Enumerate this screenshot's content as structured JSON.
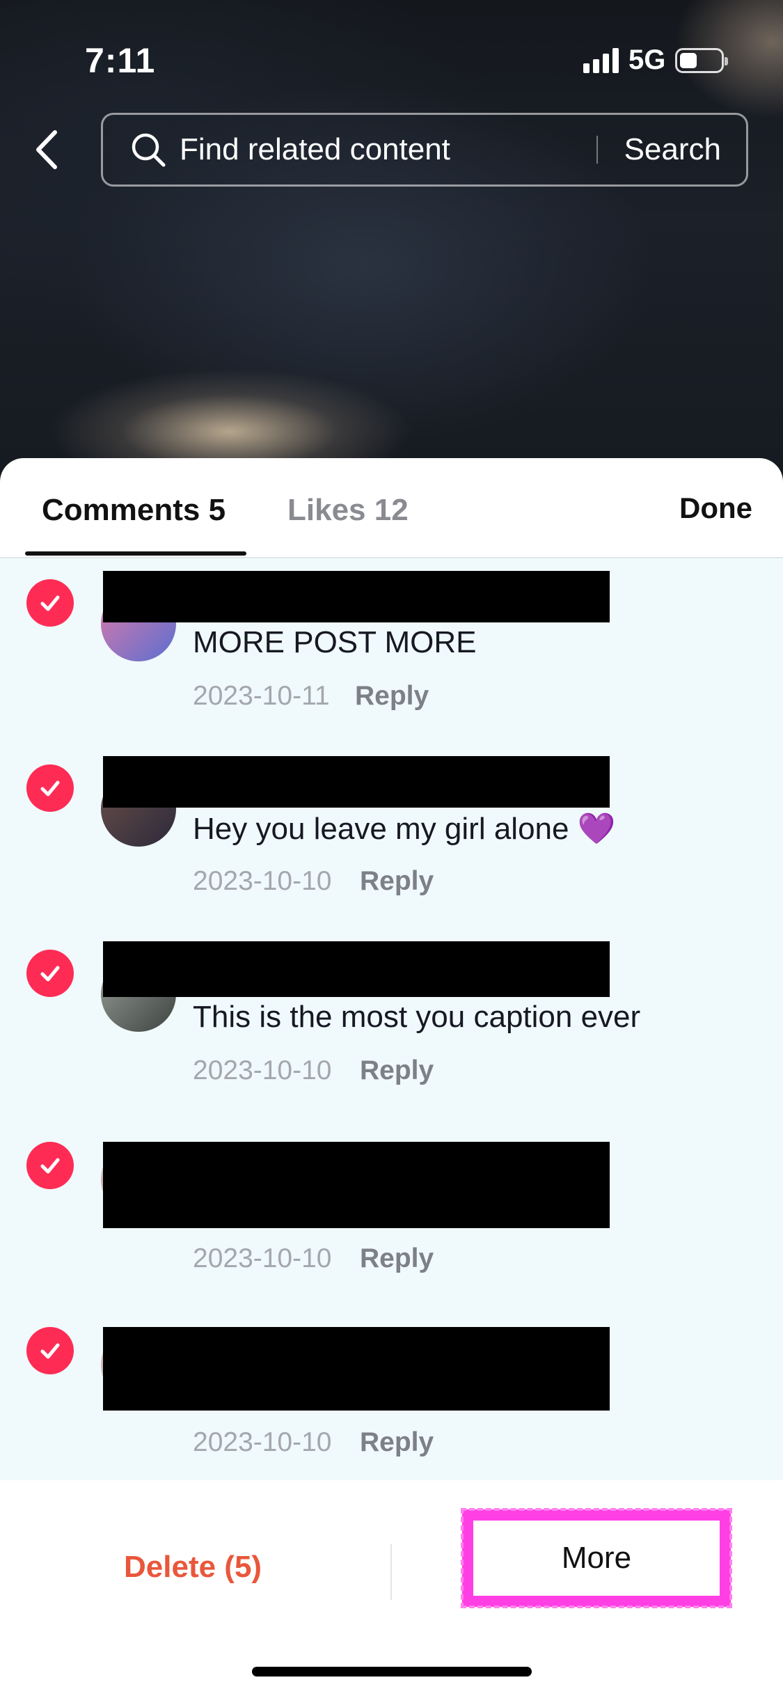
{
  "status_bar": {
    "time": "7:11",
    "network": "5G",
    "battery_level": 0.42
  },
  "header": {
    "back_icon": "chevron-left-icon",
    "search_placeholder": "Find related content",
    "search_button": "Search"
  },
  "tabs": [
    {
      "label": "Comments 5",
      "selected": true
    },
    {
      "label": "Likes 12",
      "selected": false
    }
  ],
  "done_label": "Done",
  "comments": [
    {
      "text": "MORE POST MORE",
      "date": "2023-10-11",
      "reply": "Reply",
      "checked": true
    },
    {
      "text": "Hey you leave my girl alone 💜",
      "date": "2023-10-10",
      "reply": "Reply",
      "checked": true
    },
    {
      "text": "This is the most you caption ever",
      "date": "2023-10-10",
      "reply": "Reply",
      "checked": true
    },
    {
      "text": "",
      "date": "2023-10-10",
      "reply": "Reply",
      "checked": true
    },
    {
      "text": "",
      "date": "2023-10-10",
      "reply": "Reply",
      "checked": true
    }
  ],
  "bottom_bar": {
    "delete_label": "Delete (5)",
    "more_label": "More"
  },
  "colors": {
    "accent": "#fe2c55",
    "delete": "#e9573b",
    "highlight": "#ff3fe4",
    "list_bg": "#f0f9fb"
  }
}
